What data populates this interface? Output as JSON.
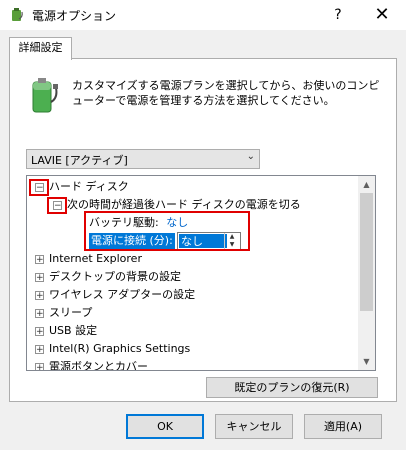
{
  "window": {
    "title": "電源オプション",
    "help": "?",
    "close": "✕"
  },
  "tab": {
    "label": "詳細設定"
  },
  "description": "カスタマイズする電源プランを選択してから、お使いのコンピューターで電源を管理する方法を選択してください。",
  "plan_select": {
    "value": "LAVIE [アクティブ]"
  },
  "tree": {
    "hard_disk": {
      "toggle": "−",
      "label": "ハード ディスク"
    },
    "turn_off": {
      "toggle": "−",
      "label": "次の時間が経過後ハード ディスクの電源を切る"
    },
    "battery": {
      "label": "バッテリ駆動:",
      "value": "なし"
    },
    "plugged_in": {
      "label": "電源に接続 (分):",
      "value": "なし"
    },
    "items": [
      {
        "toggle": "+",
        "label": "Internet Explorer"
      },
      {
        "toggle": "+",
        "label": "デスクトップの背景の設定"
      },
      {
        "toggle": "+",
        "label": "ワイヤレス アダプターの設定"
      },
      {
        "toggle": "+",
        "label": "スリープ"
      },
      {
        "toggle": "+",
        "label": "USB 設定"
      },
      {
        "toggle": "+",
        "label": "Intel(R) Graphics Settings"
      },
      {
        "toggle": "+",
        "label": "電源ボタンとカバー"
      }
    ]
  },
  "buttons": {
    "restore": "既定のプランの復元(R)",
    "ok": "OK",
    "cancel": "キャンセル",
    "apply": "適用(A)"
  },
  "colors": {
    "selection": "#0078d7",
    "annotation": "#e00000",
    "link_value": "#0066cc"
  }
}
